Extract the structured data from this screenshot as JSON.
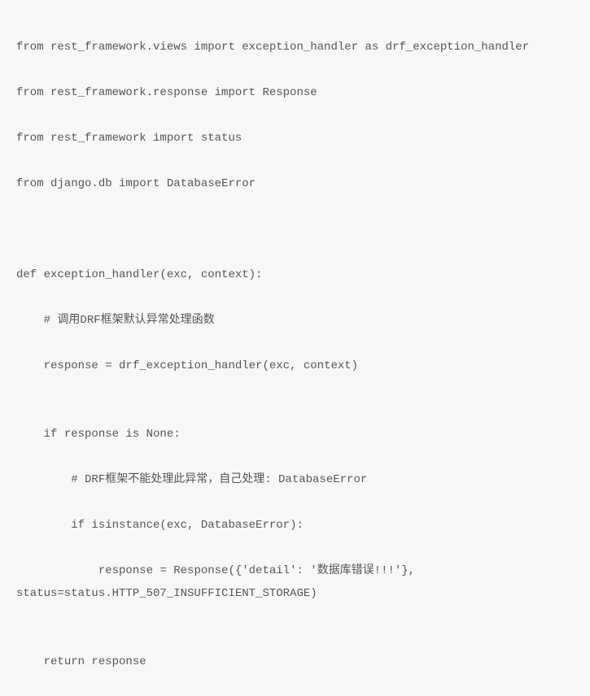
{
  "code": {
    "lines": [
      "from rest_framework.views import exception_handler as drf_exception_handler",
      "from rest_framework.response import Response",
      "from rest_framework import status",
      "from django.db import DatabaseError",
      "",
      "",
      "def exception_handler(exc, context):",
      "    # 调用DRF框架默认异常处理函数",
      "    response = drf_exception_handler(exc, context)",
      "",
      "    if response is None:",
      "        # DRF框架不能处理此异常，自己处理: DatabaseError",
      "        if isinstance(exc, DatabaseError):",
      "            response = Response({'detail': '数据库错误!!!'}, status=status.HTTP_507_INSUFFICIENT_STORAGE)",
      "",
      "    return response"
    ]
  }
}
